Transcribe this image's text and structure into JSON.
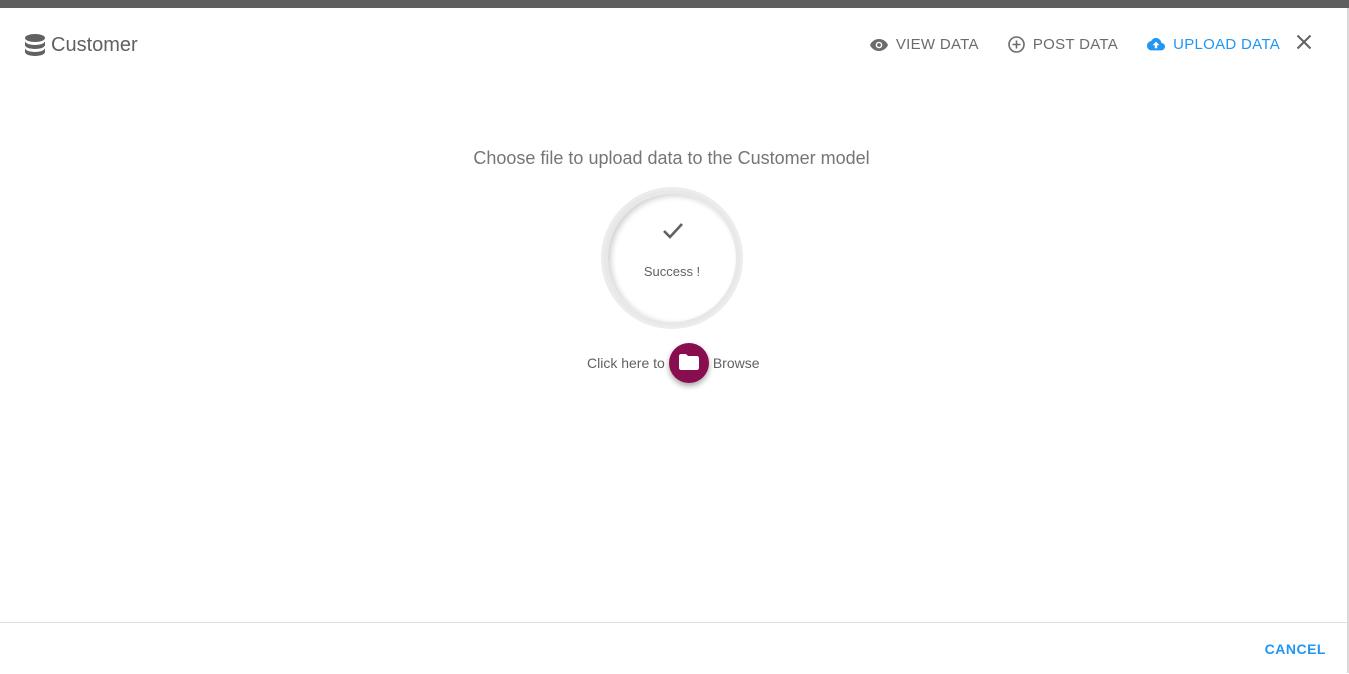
{
  "window": {
    "title": "Customer",
    "title_icon": "database-icon"
  },
  "nav": {
    "view_data": {
      "label": "VIEW DATA",
      "icon": "eye-icon"
    },
    "post_data": {
      "label": "POST DATA",
      "icon": "add-circle-icon"
    },
    "upload_data": {
      "label": "UPLOAD DATA",
      "icon": "cloud-upload-icon",
      "active": true
    },
    "close_icon": "close-icon"
  },
  "upload": {
    "prompt": "Choose file to upload data to the Customer model",
    "status_text": "Success !",
    "status_icon": "check-icon",
    "browse_prefix": "Click here to",
    "browse_icon": "folder-icon",
    "browse_suffix": "Browse"
  },
  "footer": {
    "cancel_label": "CANCEL"
  },
  "colors": {
    "accent": "#2196f3",
    "browse_button": "#880e4f",
    "top_bar": "#5f5f5f"
  }
}
